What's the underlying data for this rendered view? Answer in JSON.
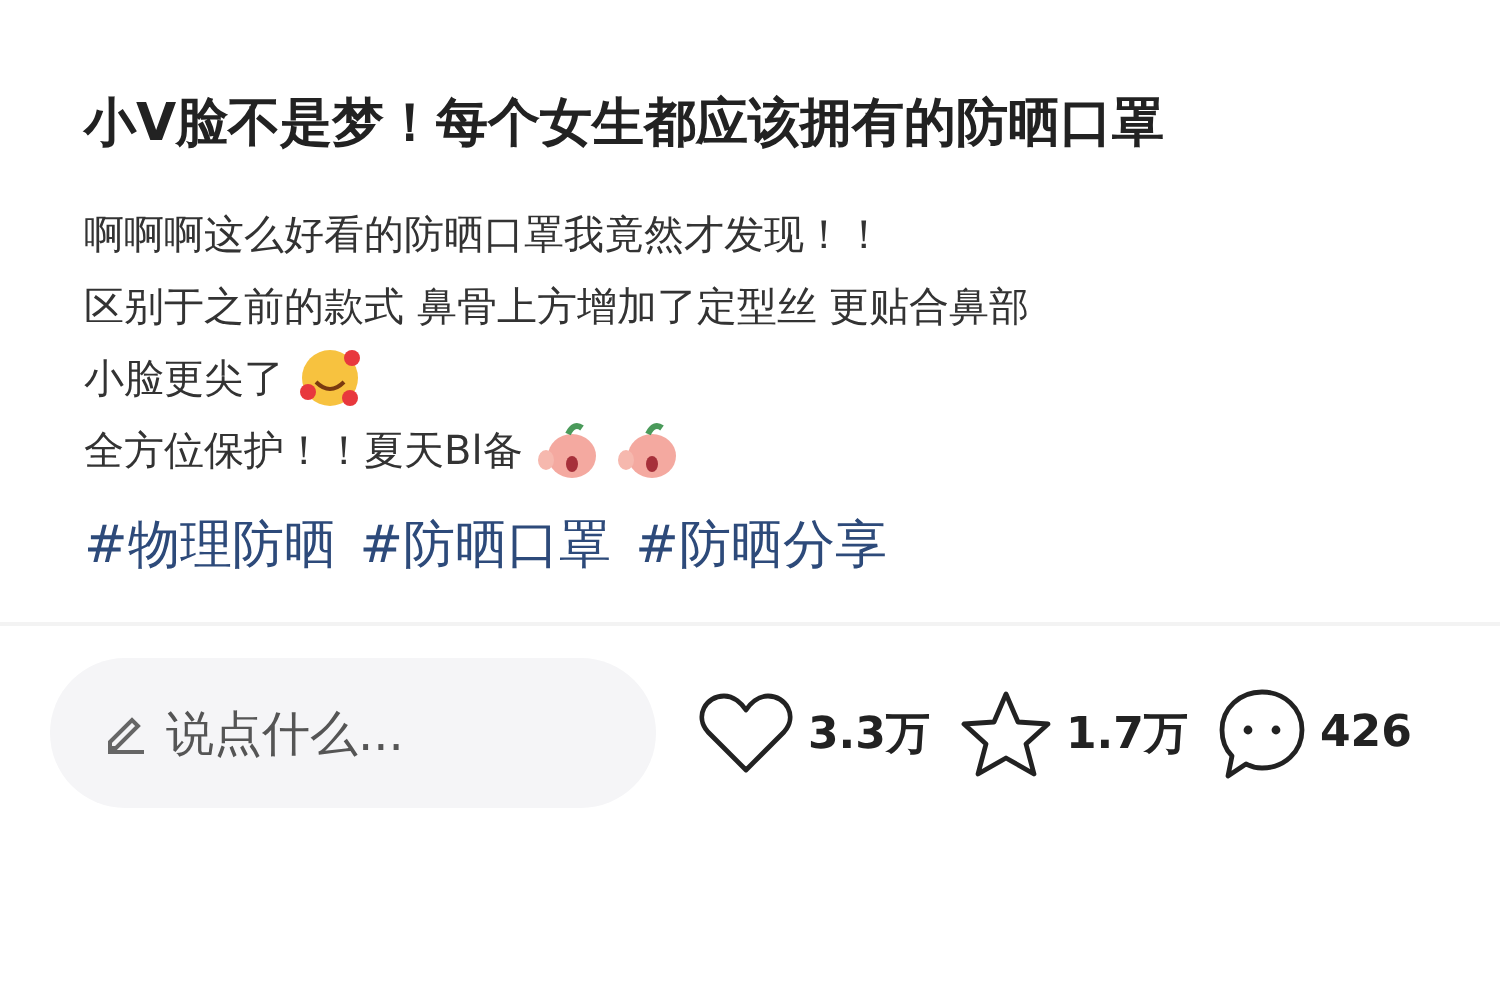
{
  "title": "小V脸不是梦！每个女生都应该拥有的防晒口罩",
  "body": [
    {
      "text": "啊啊啊这么好看的防晒口罩我竟然才发现！！"
    },
    {
      "text": "区别于之前的款式 鼻骨上方增加了定型丝 更贴合鼻部"
    },
    {
      "text": "小脸更尖了",
      "emojis": [
        {
          "kind": "hearts"
        }
      ]
    },
    {
      "text": "全方位保护！！夏天Bl备",
      "emojis": [
        {
          "kind": "peach"
        },
        {
          "kind": "peach"
        }
      ]
    }
  ],
  "tags": [
    "#物理防晒",
    "#防晒口罩",
    "#防晒分享"
  ],
  "comment": {
    "placeholder": "说点什么..."
  },
  "actions": [
    {
      "kind": "like",
      "count": "3.3万"
    },
    {
      "kind": "star",
      "count": "1.7万"
    },
    {
      "kind": "comment",
      "count": "426"
    }
  ]
}
